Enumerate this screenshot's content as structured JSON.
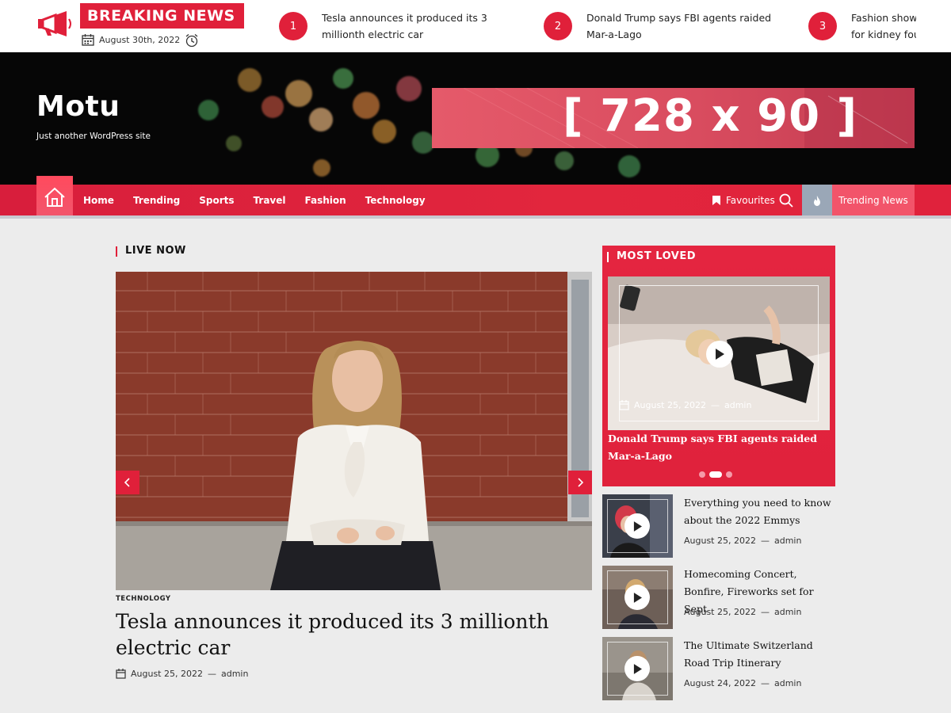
{
  "topbar": {
    "breaking_label": "BREAKING NEWS",
    "date": "August 30th, 2022",
    "ticker": [
      {
        "num": "1",
        "text": "Tesla announces it produced its 3 millionth electric car"
      },
      {
        "num": "2",
        "text": "Donald Trump says FBI agents raided Mar-a-Lago"
      },
      {
        "num": "3",
        "text": "Fashion show for kidney fou"
      }
    ]
  },
  "header": {
    "site_title": "Motu",
    "tagline": "Just another WordPress site",
    "ad_text": "[ 728 x 90 ]"
  },
  "nav": {
    "items": [
      "Home",
      "Trending",
      "Sports",
      "Travel",
      "Fashion",
      "Technology"
    ],
    "favourites": "Favourites",
    "trending_news": "Trending News"
  },
  "live": {
    "label": "LIVE NOW",
    "category": "TECHNOLOGY",
    "title": "Tesla announces it produced its 3 millionth electric car",
    "date": "August 25, 2022",
    "author": "admin",
    "separator": "—"
  },
  "most_loved": {
    "label": "MOST LOVED",
    "date": "August 25, 2022",
    "author": "admin",
    "title": "Donald Trump says FBI agents raided Mar-a-Lago"
  },
  "side_items": [
    {
      "title": "Everything you need to know about the 2022 Emmys",
      "date": "August 25, 2022",
      "author": "admin"
    },
    {
      "title": "Homecoming Concert, Bonfire, Fireworks set for Sept",
      "date": "August 25, 2022",
      "author": "admin"
    },
    {
      "title": "The Ultimate Switzerland Road Trip Itinerary",
      "date": "August 24, 2022",
      "author": "admin"
    }
  ],
  "colors": {
    "accent": "#e0203a",
    "dark": "#060606",
    "background": "#ececec"
  },
  "icons": [
    "megaphone-icon",
    "calendar-icon",
    "clock-icon",
    "home-icon",
    "bookmark-icon",
    "search-icon",
    "fire-icon",
    "play-icon",
    "chevron-left-icon",
    "chevron-right-icon"
  ]
}
